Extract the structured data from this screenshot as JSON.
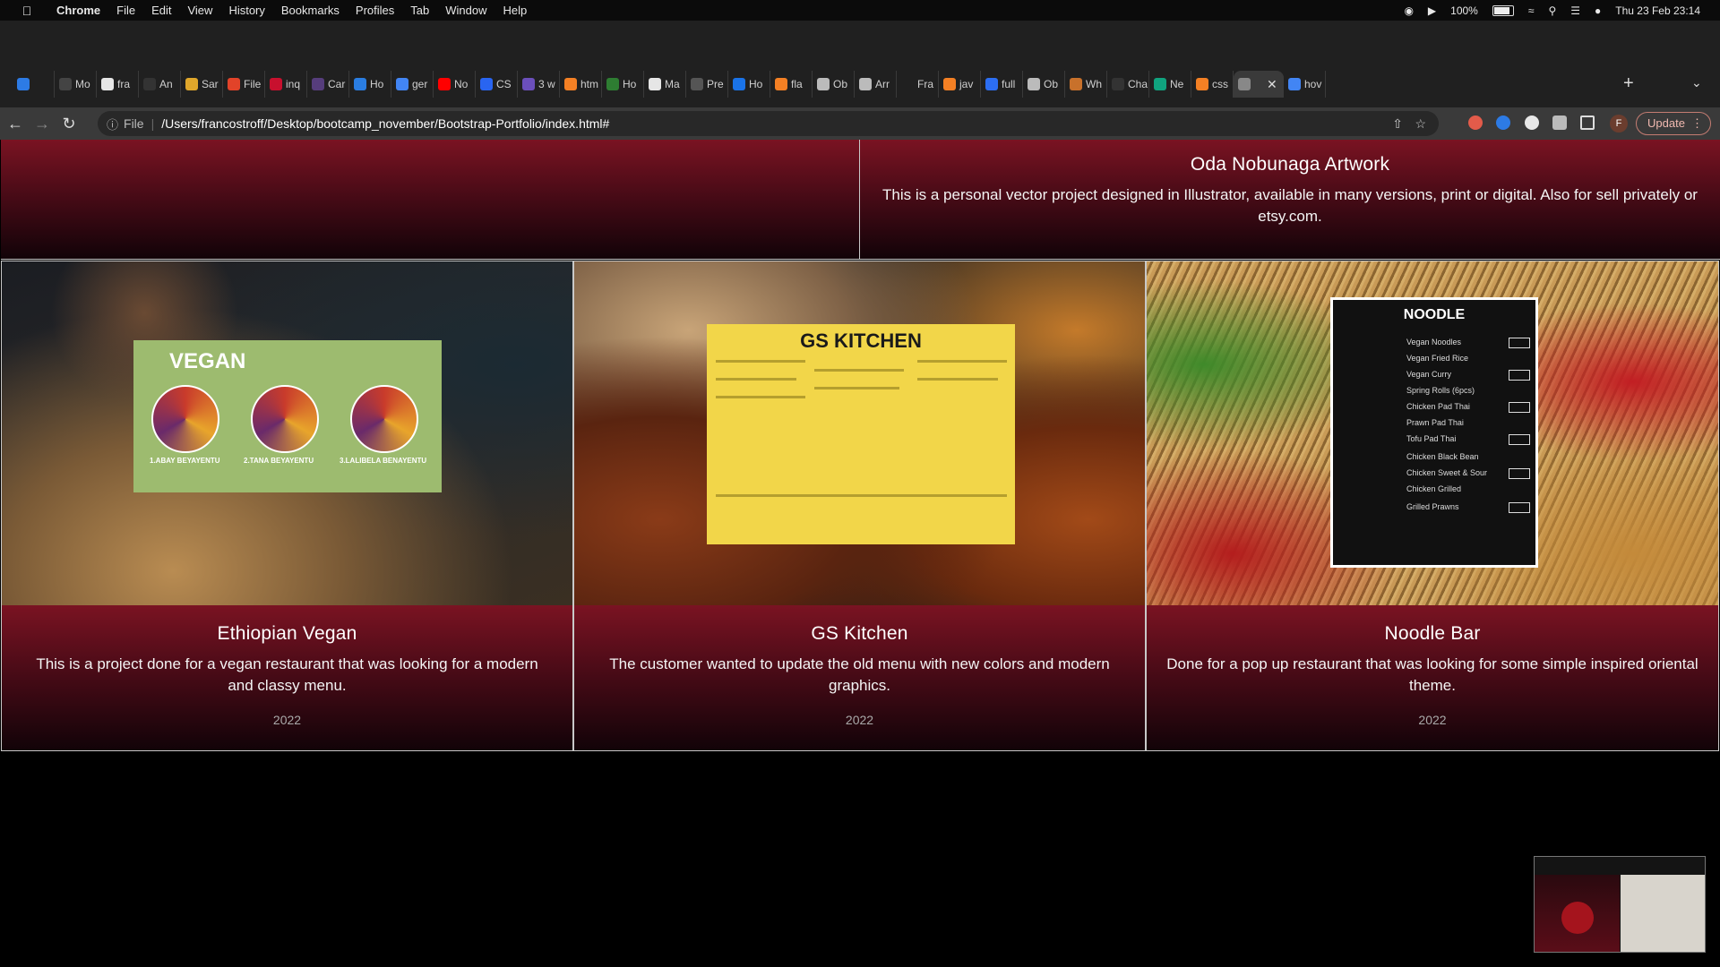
{
  "menubar": {
    "app": "Chrome",
    "menus": [
      "File",
      "Edit",
      "View",
      "History",
      "Bookmarks",
      "Profiles",
      "Tab",
      "Window",
      "Help"
    ],
    "battery": "100%",
    "clock": "Thu 23 Feb  23:14"
  },
  "tabs": [
    {
      "label": "",
      "color": "#2d7be5"
    },
    {
      "label": "Mo",
      "color": "#444"
    },
    {
      "label": "fra",
      "color": "#e6e6e6"
    },
    {
      "label": "An",
      "color": "#333"
    },
    {
      "label": "Sar",
      "color": "#e0a72b"
    },
    {
      "label": "File",
      "color": "#e24329"
    },
    {
      "label": "inq",
      "color": "#c8102e"
    },
    {
      "label": "Car",
      "color": "#563d7c"
    },
    {
      "label": "Ho",
      "color": "#2a7de1"
    },
    {
      "label": "ger",
      "color": "#4285f4"
    },
    {
      "label": "No",
      "color": "#ff0000"
    },
    {
      "label": "CS",
      "color": "#2965f1"
    },
    {
      "label": "3 w",
      "color": "#6b4fbb"
    },
    {
      "label": "htm",
      "color": "#f48024"
    },
    {
      "label": "Ho",
      "color": "#2e7d32"
    },
    {
      "label": "Ma",
      "color": "#e6e6e6"
    },
    {
      "label": "Pre",
      "color": "#555"
    },
    {
      "label": "Ho",
      "color": "#1a73e8"
    },
    {
      "label": "fla",
      "color": "#f48024"
    },
    {
      "label": "Ob",
      "color": "#bbb"
    },
    {
      "label": "Arr",
      "color": "#bbb"
    },
    {
      "label": "Fra",
      "color": "#202020"
    },
    {
      "label": "jav",
      "color": "#f48024"
    },
    {
      "label": "full",
      "color": "#2c6ef2"
    },
    {
      "label": "Ob",
      "color": "#bbb"
    },
    {
      "label": "Wh",
      "color": "#c8712b"
    },
    {
      "label": "Cha",
      "color": "#333"
    },
    {
      "label": "Ne",
      "color": "#10a37f"
    },
    {
      "label": "css",
      "color": "#f48024"
    },
    {
      "label": "",
      "color": "#888",
      "active": true
    },
    {
      "label": "hov",
      "color": "#4285f4"
    }
  ],
  "toolbar": {
    "scheme": "File",
    "url": "/Users/francostroff/Desktop/bootcamp_november/Bootstrap-Portfolio/index.html#",
    "profile_initial": "F",
    "update_label": "Update"
  },
  "projects": {
    "top": {
      "title": "Oda Nobunaga Artwork",
      "description": "This is a personal vector project designed in Illustrator, available in many versions, print or digital. Also for sell privately or etsy.com."
    },
    "cards": [
      {
        "title": "Ethiopian Vegan",
        "description": "This is a project done for a vegan restaurant that was looking for a modern and classy menu.",
        "year": "2022",
        "menu_heading": "VEGAN",
        "items": [
          "1.ABAY BEYAYENTU",
          "2.TANA BEYAYENTU",
          "3.LALIBELA BENAYENTU"
        ]
      },
      {
        "title": "GS Kitchen",
        "description": "The customer wanted to update the old menu with new colors and modern graphics.",
        "year": "2022",
        "menu_heading": "GS KITCHEN"
      },
      {
        "title": "Noodle Bar",
        "description": "Done for a pop up restaurant that was looking for some simple inspired oriental theme.",
        "year": "2022",
        "menu_heading": "NOODLE",
        "items": [
          "Vegan Noodles",
          "Vegan Fried Rice",
          "Vegan Curry",
          "Spring Rolls (6pcs)",
          "Chicken Pad Thai",
          "Prawn Pad Thai",
          "Tofu Pad Thai",
          "Chicken Black Bean",
          "Chicken Sweet & Sour",
          "Chicken Grilled",
          "Grilled Prawns"
        ]
      }
    ]
  }
}
